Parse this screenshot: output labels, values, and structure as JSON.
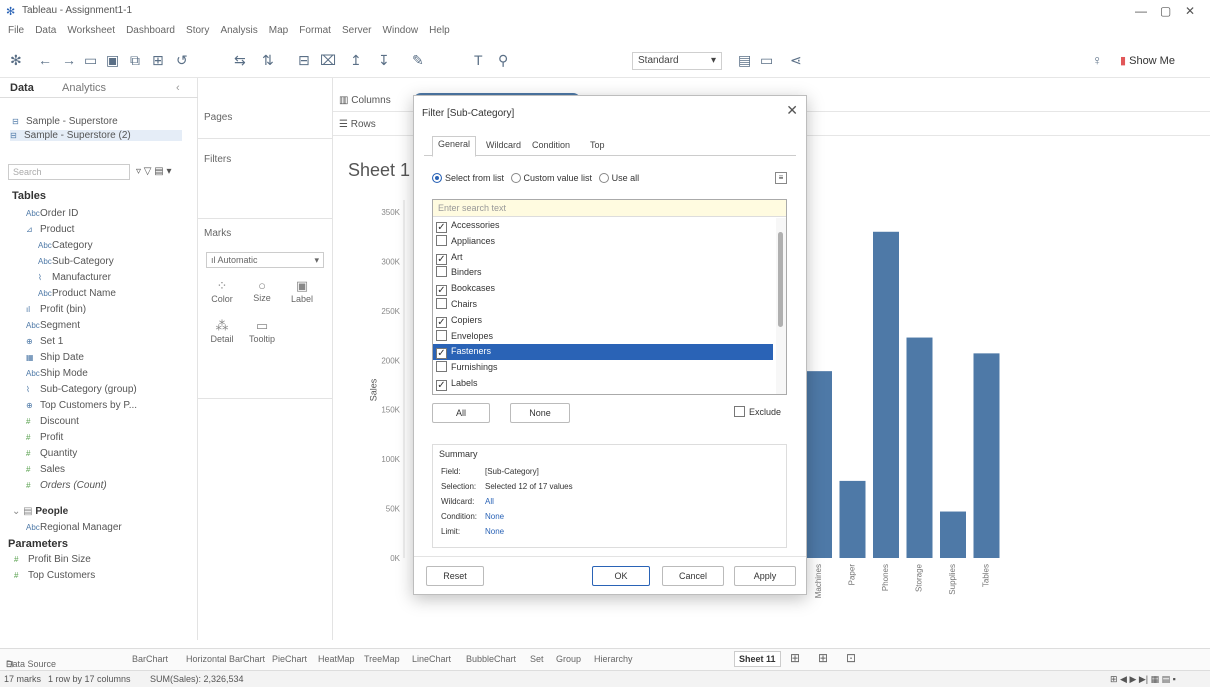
{
  "window": {
    "title": "Tableau - Assignment1-1"
  },
  "menu": [
    "File",
    "Data",
    "Worksheet",
    "Dashboard",
    "Story",
    "Analysis",
    "Map",
    "Format",
    "Server",
    "Window",
    "Help"
  ],
  "toolbar": {
    "fit_value": "Standard",
    "show_me": "Show Me"
  },
  "left_panel": {
    "tabs": [
      "Data",
      "Analytics"
    ],
    "sources": [
      "Sample - Superstore",
      "Sample - Superstore (2)"
    ],
    "search_placeholder": "Search",
    "tables_header": "Tables",
    "fields": [
      "Order ID",
      "Product",
      "Category",
      "Sub-Category",
      "Manufacturer",
      "Product Name",
      "Profit (bin)",
      "Segment",
      "Set 1",
      "Ship Date",
      "Ship Mode",
      "Sub-Category (group)",
      "Top Customers by P...",
      "Discount",
      "Profit",
      "Quantity",
      "Sales",
      "Orders (Count)"
    ],
    "people_header": "People",
    "people_fields": [
      "Regional Manager"
    ],
    "parameters_header": "Parameters",
    "parameters": [
      "Profit Bin Size",
      "Top Customers"
    ]
  },
  "cards": {
    "pages": "Pages",
    "filters": "Filters",
    "marks": "Marks",
    "mark_type": "Automatic",
    "mark_buttons": [
      "Color",
      "Size",
      "Label",
      "Detail",
      "Tooltip"
    ]
  },
  "shelves": {
    "columns": "Columns",
    "rows": "Rows"
  },
  "sheet": {
    "title": "Sheet 1"
  },
  "dialog": {
    "title": "Filter [Sub-Category]",
    "tabs": [
      "General",
      "Wildcard",
      "Condition",
      "Top"
    ],
    "radio_select": "Select from list",
    "radio_custom": "Custom value list",
    "radio_all": "Use all",
    "search_placeholder": "Enter search text",
    "items": [
      {
        "label": "Accessories",
        "checked": true,
        "selected": false
      },
      {
        "label": "Appliances",
        "checked": false,
        "selected": false
      },
      {
        "label": "Art",
        "checked": true,
        "selected": false
      },
      {
        "label": "Binders",
        "checked": false,
        "selected": false
      },
      {
        "label": "Bookcases",
        "checked": true,
        "selected": false
      },
      {
        "label": "Chairs",
        "checked": false,
        "selected": false
      },
      {
        "label": "Copiers",
        "checked": true,
        "selected": false
      },
      {
        "label": "Envelopes",
        "checked": false,
        "selected": false
      },
      {
        "label": "Fasteners",
        "checked": true,
        "selected": true
      },
      {
        "label": "Furnishings",
        "checked": false,
        "selected": false
      },
      {
        "label": "Labels",
        "checked": true,
        "selected": false
      }
    ],
    "btn_all": "All",
    "btn_none": "None",
    "exclude": "Exclude",
    "summary": {
      "header": "Summary",
      "field_k": "Field:",
      "field_v": "[Sub-Category]",
      "selection_k": "Selection:",
      "selection_v": "Selected 12 of 17 values",
      "wildcard_k": "Wildcard:",
      "wildcard_v": "All",
      "condition_k": "Condition:",
      "condition_v": "None",
      "limit_k": "Limit:",
      "limit_v": "None"
    },
    "btn_reset": "Reset",
    "btn_ok": "OK",
    "btn_cancel": "Cancel",
    "btn_apply": "Apply"
  },
  "chart_data": {
    "type": "bar",
    "ylabel": "Sales",
    "ylim": [
      0,
      350000
    ],
    "y_ticks": [
      "0K",
      "50K",
      "100K",
      "150K",
      "200K",
      "250K",
      "300K",
      "350K"
    ],
    "categories": [
      "Machines",
      "Paper",
      "Phones",
      "Storage",
      "Supplies",
      "Tables"
    ],
    "values": [
      189000,
      78000,
      330000,
      223000,
      47000,
      207000
    ],
    "bar_color": "#4e79a7"
  },
  "bottom_tabs": [
    "Data Source",
    "BarChart",
    "Horizontal BarChart",
    "PieChart",
    "HeatMap",
    "TreeMap",
    "LineChart",
    "BubbleChart",
    "Set",
    "Group",
    "Hierarchy",
    "Sheet 11"
  ],
  "status": {
    "marks": "17 marks",
    "rows": "1 row by 17 columns",
    "sum": "SUM(Sales): 2,326,534"
  }
}
